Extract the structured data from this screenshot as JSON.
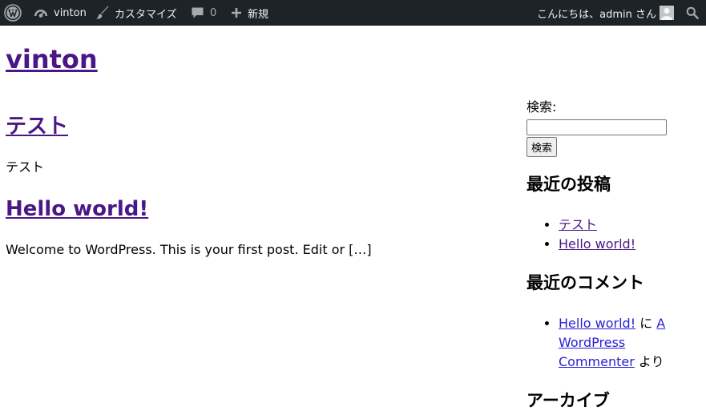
{
  "adminbar": {
    "site_name": "vinton",
    "customize": "カスタマイズ",
    "comments_count": "0",
    "new": "新規",
    "greeting": "こんにちは、admin さん"
  },
  "site": {
    "title": "vinton"
  },
  "posts": [
    {
      "title": "テスト",
      "excerpt": "テスト"
    },
    {
      "title": "Hello world!",
      "excerpt": "Welcome to WordPress. This is your first post. Edit or […]"
    }
  ],
  "sidebar": {
    "search_label": "検索:",
    "search_value": "",
    "search_button": "検索",
    "recent_posts_title": "最近の投稿",
    "recent_posts": [
      "テスト",
      "Hello world!"
    ],
    "recent_comments_title": "最近のコメント",
    "recent_comment": {
      "post": "Hello world!",
      "connector": " に ",
      "author_line1": "A",
      "author_line2": "WordPress",
      "author_line3": "Commenter",
      "suffix": " より"
    },
    "archives_title": "アーカイブ"
  }
}
